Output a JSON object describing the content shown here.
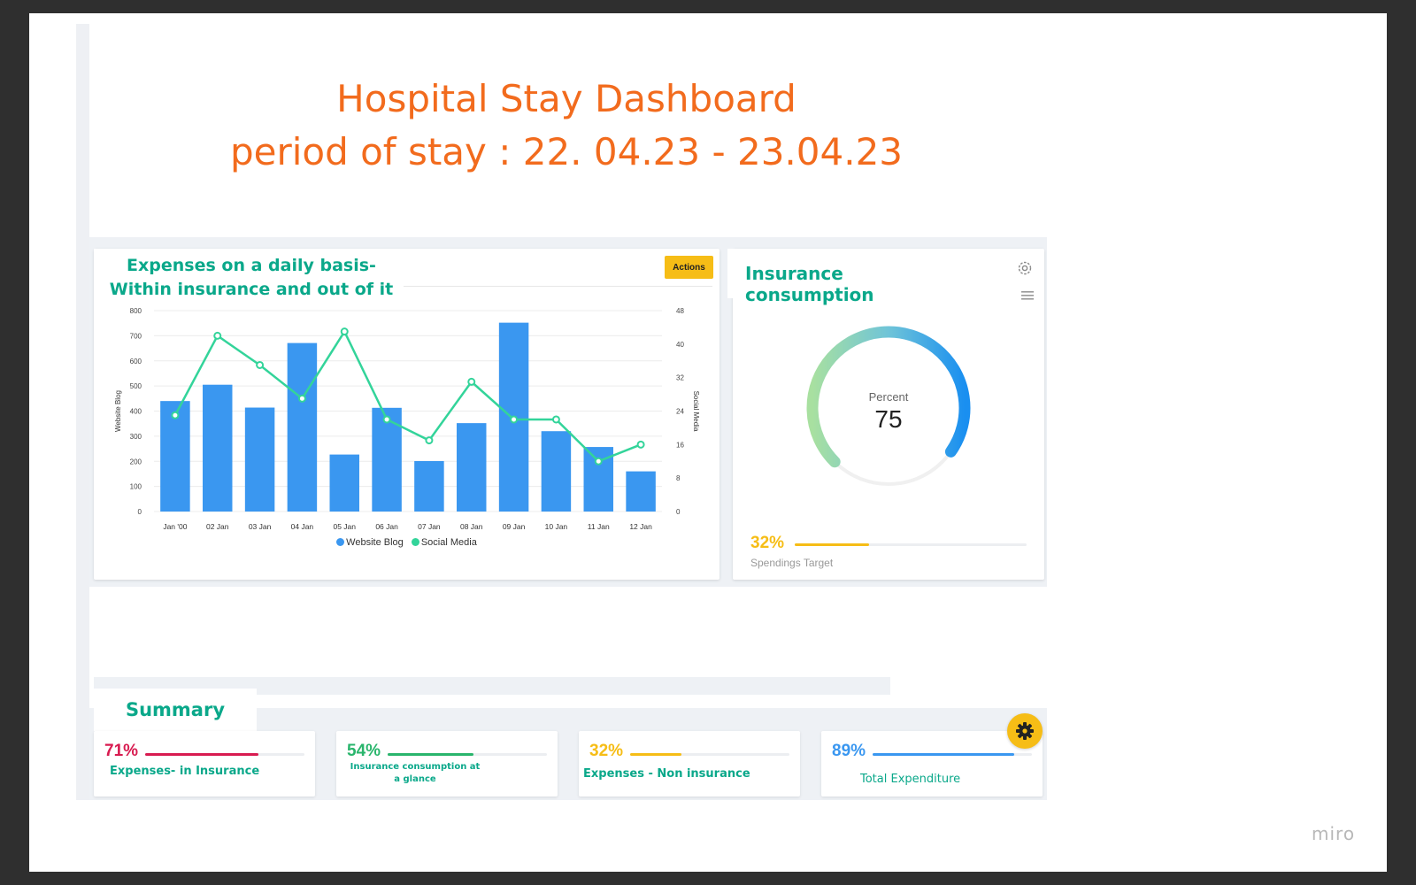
{
  "page": {
    "title_line1": "Hospital Stay Dashboard",
    "title_line2": "period of stay : 22. 04.23 - 23.04.23",
    "watermark": "miro"
  },
  "expenses_panel": {
    "title": "Expenses on a daily basis- Within insurance and out of it",
    "actions_label": "Actions"
  },
  "chart_data": {
    "type": "bar",
    "title": "",
    "categories": [
      "Jan '00",
      "02 Jan",
      "03 Jan",
      "04 Jan",
      "05 Jan",
      "06 Jan",
      "07 Jan",
      "08 Jan",
      "09 Jan",
      "10 Jan",
      "11 Jan",
      "12 Jan"
    ],
    "series": [
      {
        "name": "Website Blog",
        "type": "bar",
        "axis": "left",
        "color": "#3a97f0",
        "values": [
          440,
          505,
          414,
          671,
          227,
          413,
          201,
          352,
          752,
          320,
          257,
          160
        ]
      },
      {
        "name": "Social Media",
        "type": "line",
        "axis": "right",
        "color": "#33d49a",
        "values": [
          23,
          42,
          35,
          27,
          43,
          22,
          17,
          31,
          22,
          22,
          12,
          16
        ]
      }
    ],
    "ylabel": "Website Blog",
    "y2label": "Social Media",
    "ylim": [
      0,
      800
    ],
    "y2lim": [
      0,
      48
    ],
    "yticks": [
      "800",
      "700",
      "600",
      "500",
      "400",
      "300",
      "200",
      "100",
      "0"
    ],
    "y2ticks": [
      "48",
      "40",
      "32",
      "24",
      "16",
      "8",
      "0"
    ],
    "grid": true,
    "legend": "bottom"
  },
  "insurance_panel": {
    "title": "Insurance consumption",
    "gauge_label": "Percent",
    "gauge_value": 75,
    "target_percent": "32%",
    "target_fraction": 0.32,
    "target_label": "Spendings Target"
  },
  "summary": {
    "title": "Summary",
    "kpis": [
      {
        "percent": "71%",
        "fraction": 0.71,
        "label": "Expenses- in Insurance",
        "color": "#d81b50"
      },
      {
        "percent": "54%",
        "fraction": 0.54,
        "label": "Insurance consumption at a glance",
        "color": "#29b56c"
      },
      {
        "percent": "32%",
        "fraction": 0.32,
        "label": "Expenses - Non insurance",
        "color": "#f6bd16"
      },
      {
        "percent": "89%",
        "fraction": 0.89,
        "label": "Total Expenditure",
        "color": "#3a97f0"
      }
    ]
  }
}
